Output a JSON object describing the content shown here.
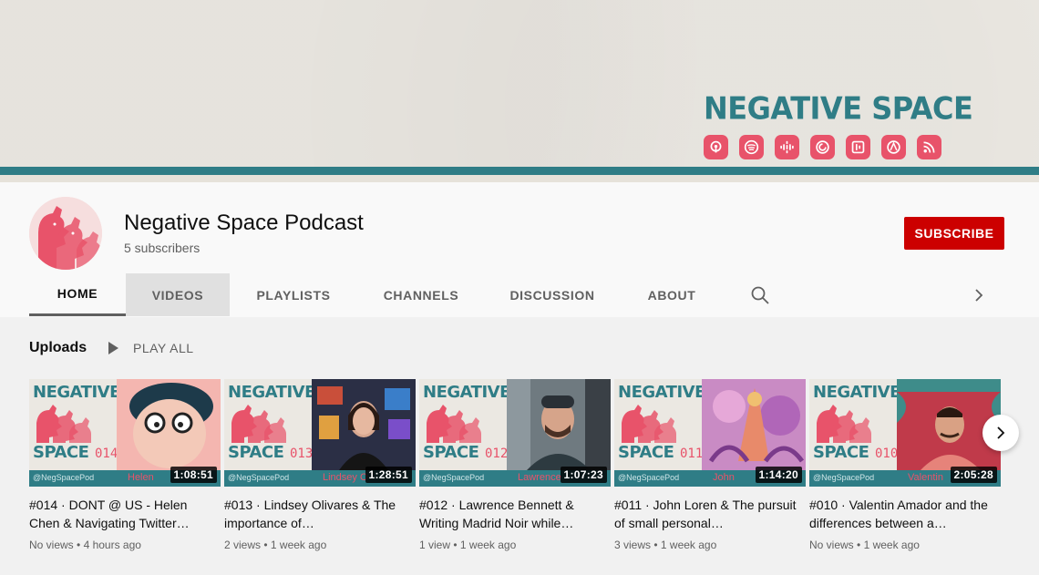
{
  "banner": {
    "title": "NEGATIVE SPACE",
    "icons": [
      "apple-podcasts-icon",
      "spotify-icon",
      "google-podcasts-icon",
      "pocket-casts-icon",
      "castbox-icon",
      "overcast-icon",
      "rss-icon"
    ]
  },
  "channel": {
    "name": "Negative Space Podcast",
    "subscribers": "5 subscribers",
    "subscribe_label": "SUBSCRIBE"
  },
  "tabs": [
    "HOME",
    "VIDEOS",
    "PLAYLISTS",
    "CHANNELS",
    "DISCUSSION",
    "ABOUT"
  ],
  "active_tab": "HOME",
  "hovered_tab": "VIDEOS",
  "uploads": {
    "title": "Uploads",
    "play_all": "PLAY ALL"
  },
  "thumbnail_common": {
    "negative": "NEGATIVE",
    "space": "SPACE",
    "handle": "@NegSpacePod"
  },
  "videos": [
    {
      "ep": "014",
      "guest": "Helen",
      "duration": "1:08:51",
      "title": "#014 · DONT @ US - Helen Chen & Navigating Twitter…",
      "views": "No views",
      "age": "4 hours ago"
    },
    {
      "ep": "013",
      "guest": "Lindsey O",
      "duration": "1:28:51",
      "title": "#013 · Lindsey Olivares & The importance of…",
      "views": "2 views",
      "age": "1 week ago"
    },
    {
      "ep": "012",
      "guest": "Lawrence",
      "duration": "1:07:23",
      "title": "#012 · Lawrence Bennett & Writing Madrid Noir while…",
      "views": "1 view",
      "age": "1 week ago"
    },
    {
      "ep": "011",
      "guest": "John",
      "duration": "1:14:20",
      "title": "#011 · John Loren & The pursuit of small personal…",
      "views": "3 views",
      "age": "1 week ago"
    },
    {
      "ep": "010",
      "guest": "Valentin",
      "duration": "2:05:28",
      "title": "#010 · Valentin Amador and the differences between a…",
      "views": "No views",
      "age": "1 week ago"
    }
  ],
  "colors": {
    "teal": "#2f7d86",
    "coral": "#e8536a",
    "subscribe_red": "#cc0000"
  }
}
